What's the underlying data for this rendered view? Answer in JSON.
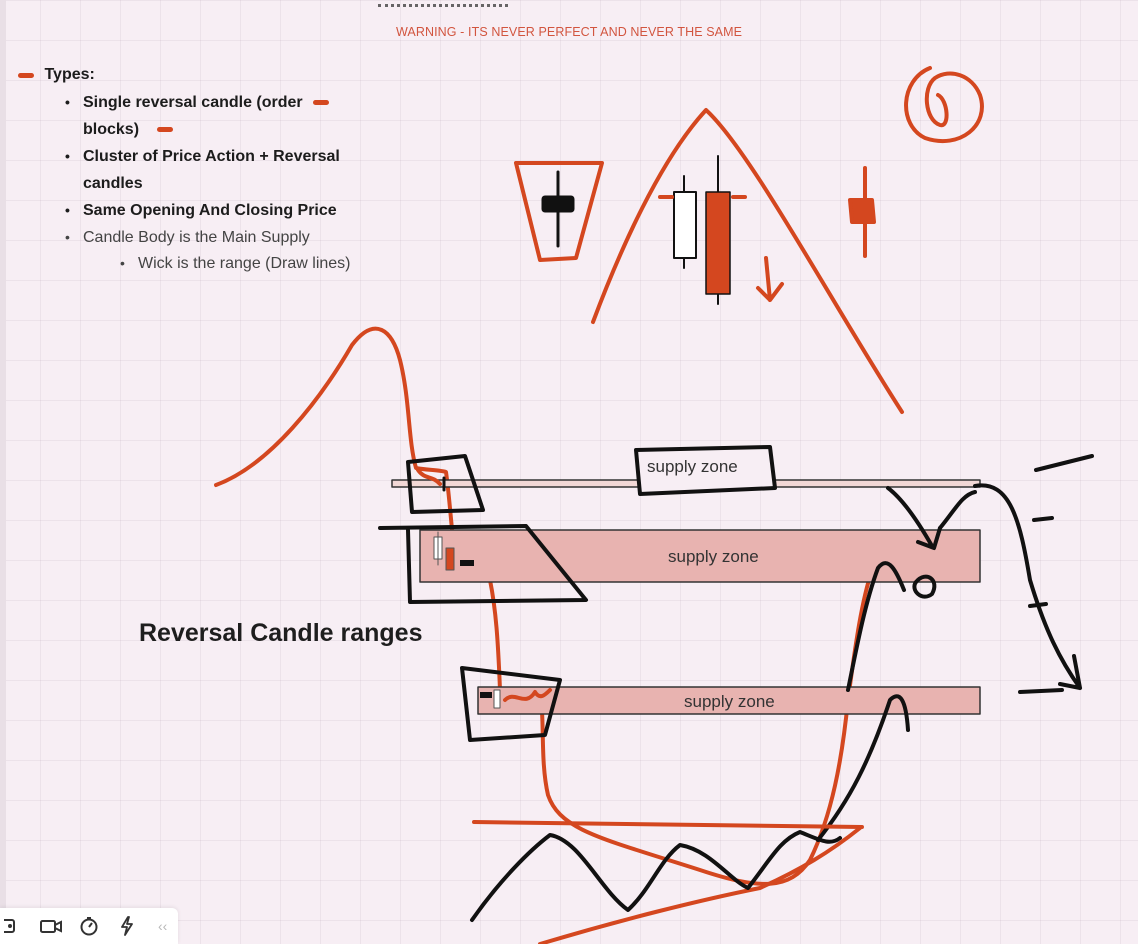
{
  "header": {
    "warning": "WARNING - ITS NEVER PERFECT AND NEVER THE SAME"
  },
  "notes": {
    "heading": "Types:",
    "items": [
      {
        "text_line1": "Single reversal candle (order",
        "text_line2": "blocks)"
      },
      {
        "text_line1": "Cluster of Price Action + Reversal",
        "text_line2": "candles"
      },
      {
        "text_line1": "Same Opening And Closing Price"
      },
      {
        "text_line1": "Candle Body is the Main Supply"
      }
    ],
    "sub_item": "Wick is the range (Draw lines)"
  },
  "zones": [
    {
      "label": "supply zone"
    },
    {
      "label": "supply zone"
    },
    {
      "label": "supply zone"
    }
  ],
  "canvas_heading": "Reversal Candle ranges",
  "toolbar": {
    "collapse": "‹‹",
    "icons": [
      "frame-icon",
      "video-camera-icon",
      "timer-icon",
      "lightning-icon"
    ]
  },
  "colors": {
    "ink_red": "#d4471f",
    "ink_black": "#111111",
    "zone_fill": "#e8b3b0",
    "warning": "#d2553f"
  }
}
